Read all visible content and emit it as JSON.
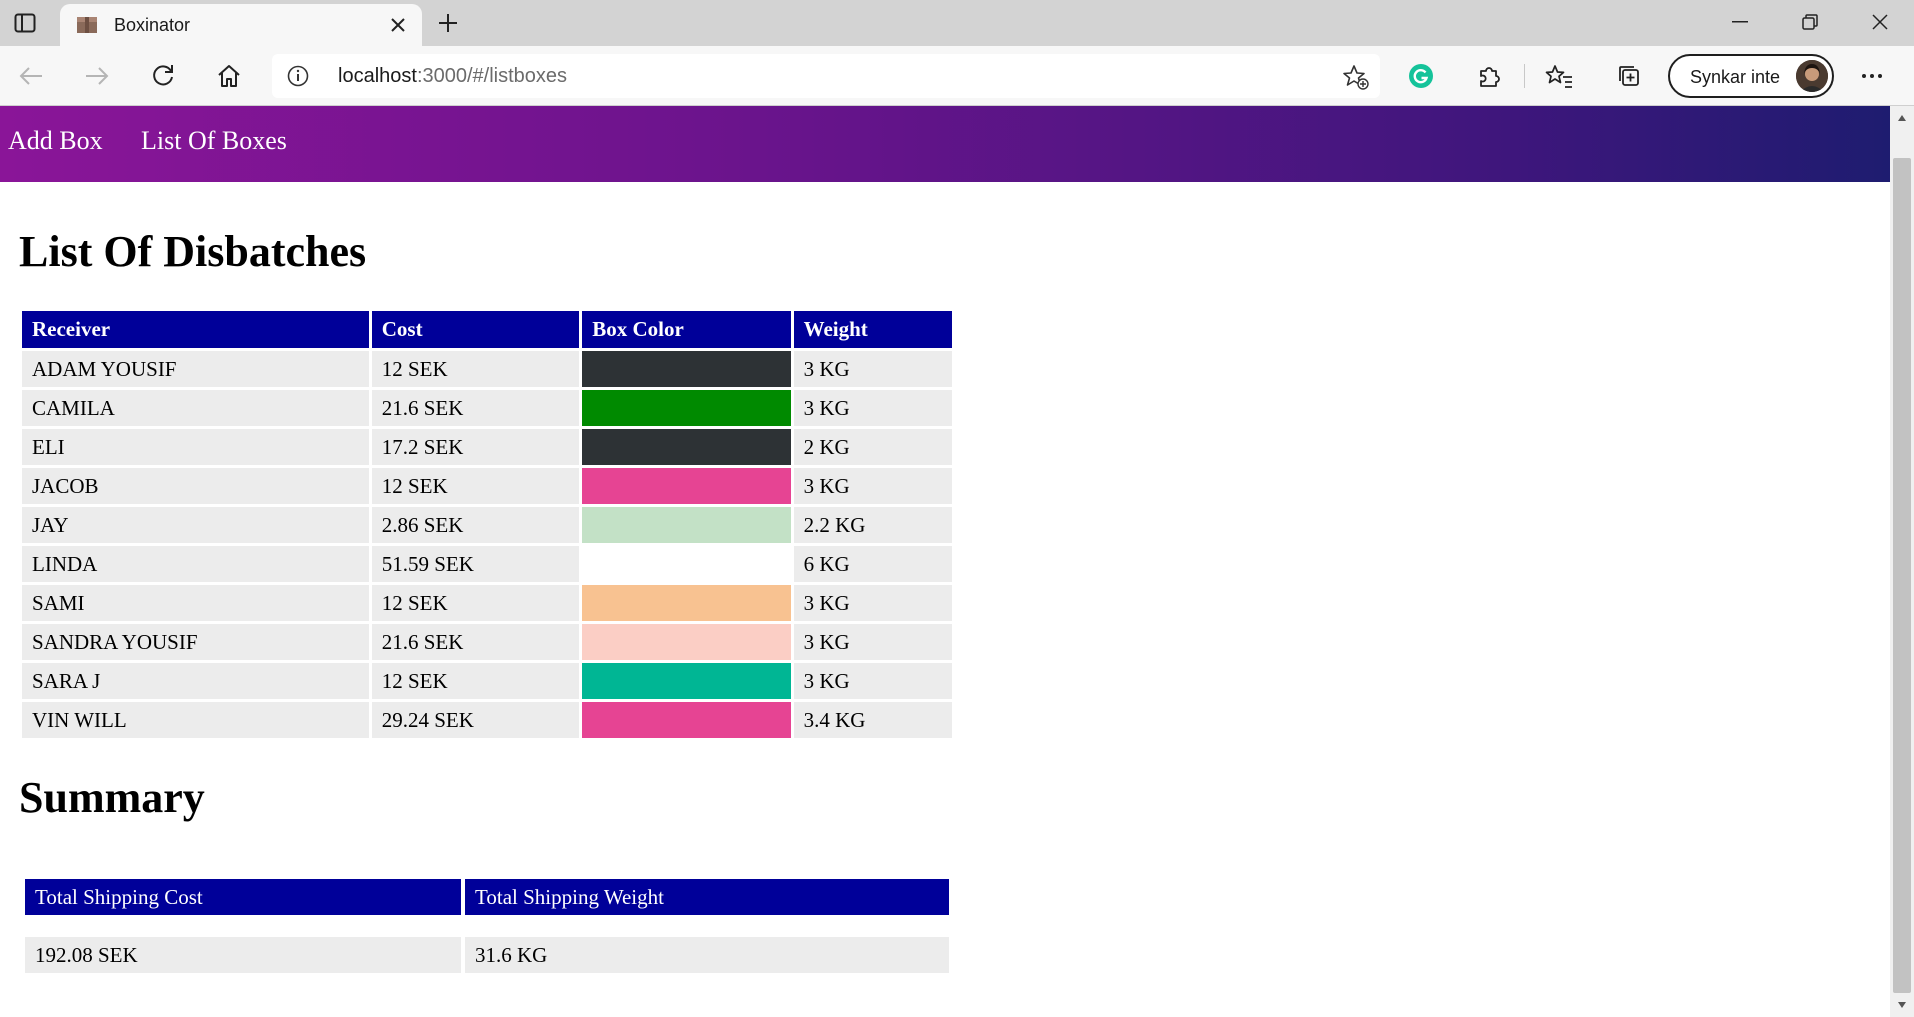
{
  "browser": {
    "tab_title": "Boxinator",
    "url_host": "localhost",
    "url_rest": ":3000/#/listboxes",
    "profile_label": "Synkar inte"
  },
  "nav": {
    "add_box": "Add Box",
    "list_boxes": "List Of Boxes"
  },
  "page": {
    "title": "List Of Disbatches",
    "summary_title": "Summary"
  },
  "table": {
    "headers": [
      "Receiver",
      "Cost",
      "Box Color",
      "Weight"
    ],
    "rows": [
      {
        "receiver": "ADAM YOUSIF",
        "cost": "12 SEK",
        "color": "#2d3235",
        "weight": "3 KG"
      },
      {
        "receiver": "CAMILA",
        "cost": "21.6 SEK",
        "color": "#008a00",
        "weight": "3 KG"
      },
      {
        "receiver": "ELI",
        "cost": "17.2 SEK",
        "color": "#2d3235",
        "weight": "2 KG"
      },
      {
        "receiver": "JACOB",
        "cost": "12 SEK",
        "color": "#e64493",
        "weight": "3 KG"
      },
      {
        "receiver": "JAY",
        "cost": "2.86 SEK",
        "color": "#c3e1c6",
        "weight": "2.2 KG"
      },
      {
        "receiver": "LINDA",
        "cost": "51.59 SEK",
        "color": "#ffffff",
        "weight": "6 KG"
      },
      {
        "receiver": "SAMI",
        "cost": "12 SEK",
        "color": "#f8c291",
        "weight": "3 KG"
      },
      {
        "receiver": "SANDRA YOUSIF",
        "cost": "21.6 SEK",
        "color": "#fbcec5",
        "weight": "3 KG"
      },
      {
        "receiver": "SARA J",
        "cost": "12 SEK",
        "color": "#00b694",
        "weight": "3 KG"
      },
      {
        "receiver": "VIN WILL",
        "cost": "29.24 SEK",
        "color": "#e64493",
        "weight": "3.4 KG"
      }
    ]
  },
  "summary": {
    "headers": [
      "Total Shipping Cost",
      "Total Shipping Weight"
    ],
    "values": [
      "192.08 SEK",
      "31.6 KG"
    ]
  },
  "colors": {
    "header_bg": "#000099",
    "row_bg": "#ececec",
    "nav_gradient_start": "#8a1598",
    "nav_gradient_end": "#1e1c70"
  }
}
